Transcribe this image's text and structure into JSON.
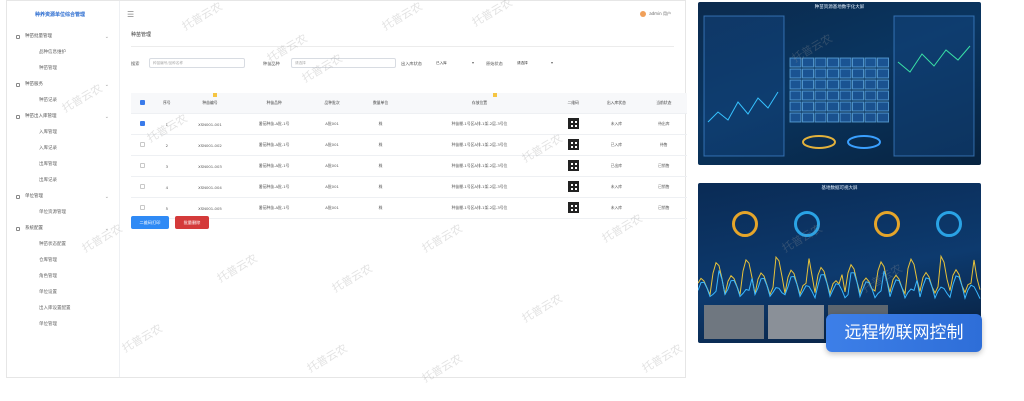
{
  "app": {
    "brand": "种养资源单位综合管理",
    "page_title": "种苗管理",
    "user_label": "admin 用户"
  },
  "sidebar": {
    "groups": [
      {
        "label": "种苗批量管理",
        "items": [
          "品种信息维护",
          "种苗管理"
        ]
      },
      {
        "label": "种苗服务",
        "items": [
          "种苗记录"
        ]
      },
      {
        "label": "种苗出入库管理",
        "items": [
          "入库管理",
          "入库记录",
          "出库管理",
          "出库记录"
        ]
      },
      {
        "label": "单位管理",
        "items": [
          "单位资源管理"
        ]
      },
      {
        "label": "系统配置",
        "items": [
          "种苗状态配置",
          "仓库管理",
          "角色管理",
          "单位设置",
          "出入库设置配置",
          "单位管理"
        ]
      }
    ]
  },
  "filters": {
    "search_label": "搜索",
    "search_placeholder": "种苗编号/品种名称",
    "category_label": "种苗品种",
    "category_placeholder": "请选择",
    "status_label": "出入库状态",
    "status_value": "已入库",
    "origin_label": "原始状态",
    "origin_value": "请选择"
  },
  "table": {
    "headers": [
      "",
      "序号",
      "种苗编号",
      "种苗品种",
      "品种批次",
      "数量单位",
      "存放位置",
      "二维码",
      "出入库状态",
      "当前状态"
    ],
    "rows": [
      {
        "checked": true,
        "no": "1",
        "code": "XSN001-001",
        "variety": "番茄种苗-A批-1号",
        "batch": "A批001",
        "unit": "株",
        "location": "种苗棚-1号区A排-1架-2层-3号位",
        "status": "未入库",
        "state": "待出库"
      },
      {
        "checked": false,
        "no": "2",
        "code": "XSN001-002",
        "variety": "番茄种苗-A批-1号",
        "batch": "A批001",
        "unit": "株",
        "location": "种苗棚-1号区A排-1架-2层-3号位",
        "status": "已入库",
        "state": "待售"
      },
      {
        "checked": false,
        "no": "3",
        "code": "XSN001-003",
        "variety": "番茄种苗-A批-1号",
        "batch": "A批001",
        "unit": "株",
        "location": "种苗棚-1号区A排-1架-2层-3号位",
        "status": "已出库",
        "state": "已销售"
      },
      {
        "checked": false,
        "no": "4",
        "code": "XSN001-004",
        "variety": "番茄种苗-A批-1号",
        "batch": "A批001",
        "unit": "株",
        "location": "种苗棚-1号区A排-1架-2层-3号位",
        "status": "未入库",
        "state": "已销售"
      },
      {
        "checked": false,
        "no": "5",
        "code": "XSN001-005",
        "variety": "番茄种苗-A批-1号",
        "batch": "A批001",
        "unit": "株",
        "location": "种苗棚-1号区A排-1架-2层-3号位",
        "status": "未入库",
        "state": "已销售"
      }
    ]
  },
  "actions": {
    "print_label": "二维码打印",
    "batch_delete_label": "批量删除"
  },
  "screens": {
    "top_title": "种苗资源基地数字化大屏",
    "bottom_title": "基地数据可视大屏",
    "callout": "远程物联网控制"
  },
  "watermark": "托普云农",
  "colors": {
    "primary": "#2f8af5",
    "danger": "#d43a3a",
    "callout": "#3d7fe8"
  }
}
